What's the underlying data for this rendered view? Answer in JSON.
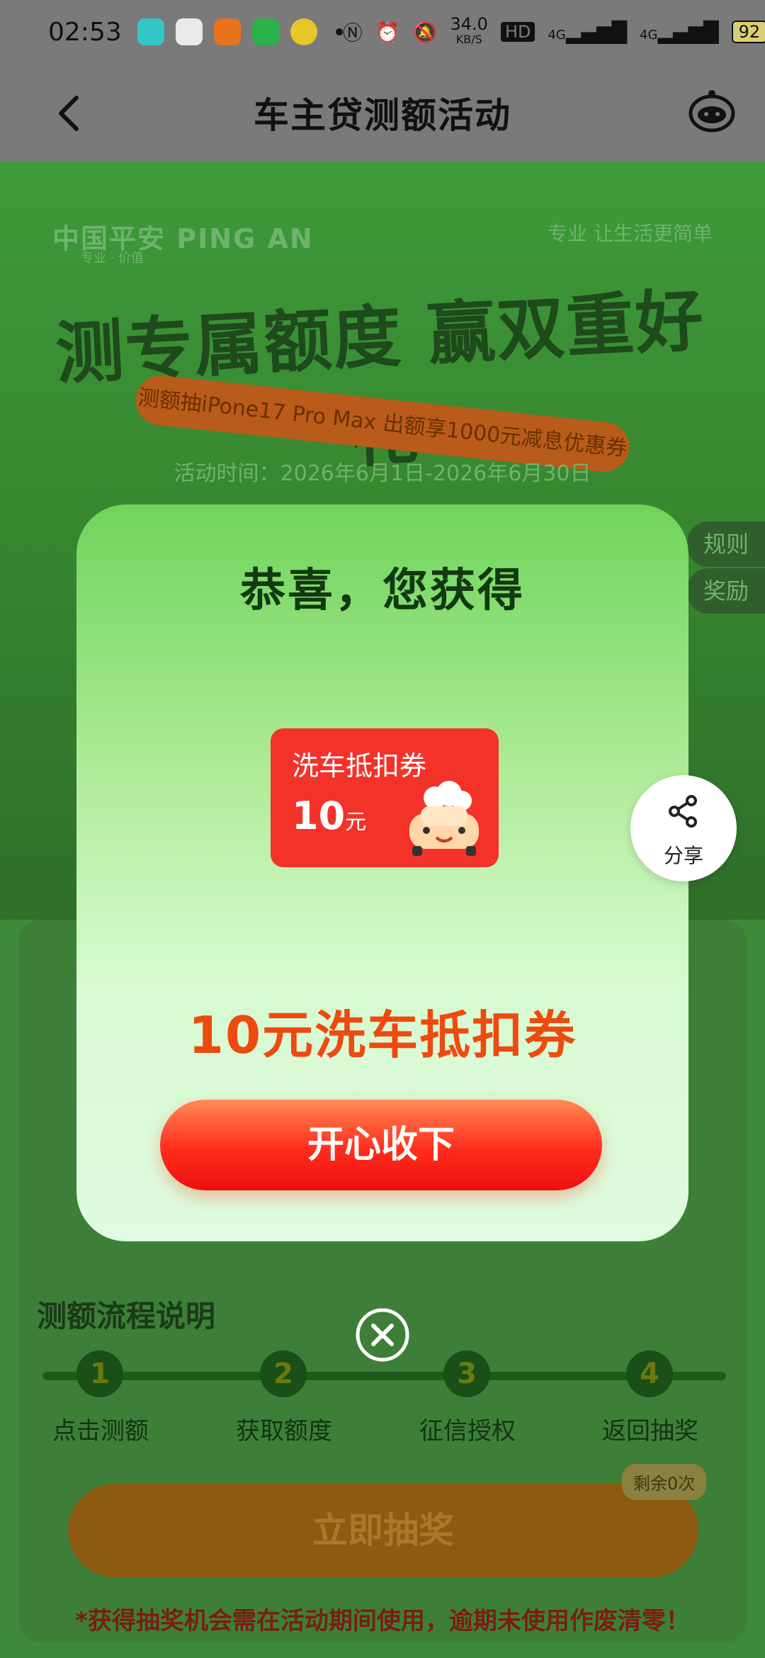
{
  "status_bar": {
    "time": "02:53",
    "network_speed": "34.0",
    "network_speed_unit": "KB/S",
    "hd_label": "HD",
    "signal_1": "4G",
    "signal_2": "4G",
    "battery": "92"
  },
  "nav": {
    "title": "车主贷测额活动"
  },
  "banner": {
    "brand": "中国平安 PING AN",
    "brand_sub": "专业 · 价值",
    "slogan": "专业 让生活更简单",
    "headline": "测专属额度 赢双重好礼",
    "ribbon": "测额抽iPone17 Pro Max  出额享1000元减息优惠券",
    "period": "活动时间：2026年6月1日-2026年6月30日",
    "side_tabs": [
      "规则",
      "奖励"
    ]
  },
  "process": {
    "title": "测额流程说明",
    "steps": [
      {
        "num": "1",
        "label": "点击测额"
      },
      {
        "num": "2",
        "label": "获取额度"
      },
      {
        "num": "3",
        "label": "征信授权"
      },
      {
        "num": "4",
        "label": "返回抽奖"
      }
    ]
  },
  "draw": {
    "button_label": "立即抽奖",
    "remaining": "剩余0次",
    "warning": "*获得抽奖机会需在活动期间使用，逾期未使用作废清零！"
  },
  "modal": {
    "title": "恭喜，您获得",
    "coupon_title": "洗车抵扣券",
    "coupon_value": "10",
    "coupon_unit": "元",
    "prize_name": "10元洗车抵扣券",
    "confirm_label": "开心收下"
  },
  "share": {
    "label": "分享"
  },
  "colors": {
    "accent_green": "#6fd45a",
    "prize_orange": "#ee4a10",
    "button_red": "#ff2d1d",
    "coupon_red": "#f3322a"
  }
}
